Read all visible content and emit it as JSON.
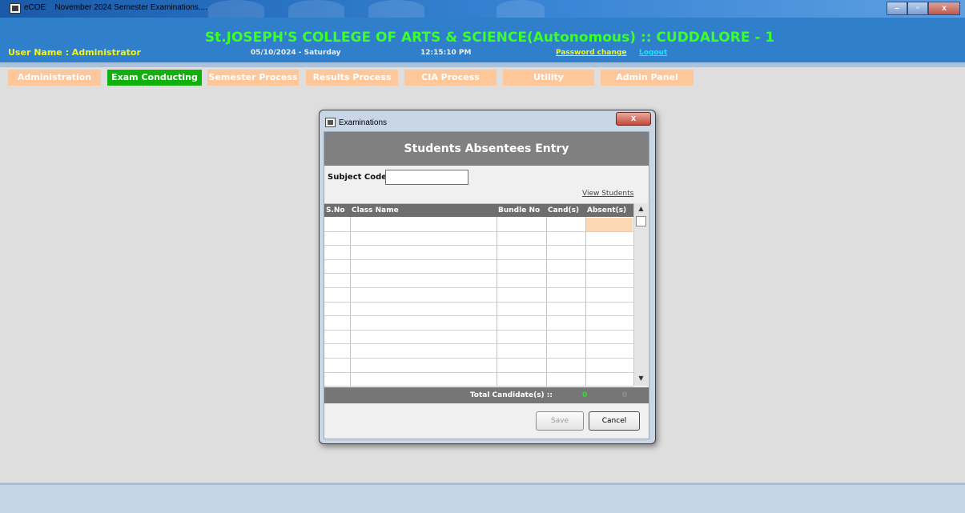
{
  "window": {
    "app_name": "eCOE",
    "title": "November 2024 Semester Examinations....",
    "controls": [
      "–",
      "▫",
      "x"
    ]
  },
  "header": {
    "college": "St.JOSEPH'S COLLEGE OF ARTS & SCIENCE(Autonomous) :: CUDDALORE - 1",
    "username": "User Name : Administrator",
    "date": "05/10/2024 - Saturday",
    "time": "12:15:10 PM",
    "password_link": "Password change",
    "logout_link": "Logout"
  },
  "menu": {
    "items": [
      {
        "label": "Administration",
        "active": false
      },
      {
        "label": "Exam Conducting",
        "active": true
      },
      {
        "label": "Semester Process",
        "active": false
      },
      {
        "label": "Results Process",
        "active": false
      },
      {
        "label": "CIA Process",
        "active": false
      },
      {
        "label": "Utility",
        "active": false
      },
      {
        "label": "Admin Panel",
        "active": false
      }
    ]
  },
  "dialog": {
    "title": "Examinations",
    "close_label": "x",
    "heading": "Students Absentees Entry",
    "subject_code_label": "Subject Code",
    "subject_code_value": "",
    "view_students_link": "View Students",
    "columns": [
      "S.No",
      "Class Name",
      "Bundle No",
      "Cand(s)",
      "Absent(s)"
    ],
    "total_label": "Total Candidate(s) ::",
    "total_candidates": "0",
    "total_absent": "0",
    "save_label": "Save",
    "cancel_label": "Cancel"
  },
  "colors": {
    "header_bg": "#2f7fca",
    "college_text": "#3aff2a",
    "menu_item": "#fdc79a",
    "menu_active": "#10b10c",
    "dialog_heading_bg": "#808080"
  }
}
